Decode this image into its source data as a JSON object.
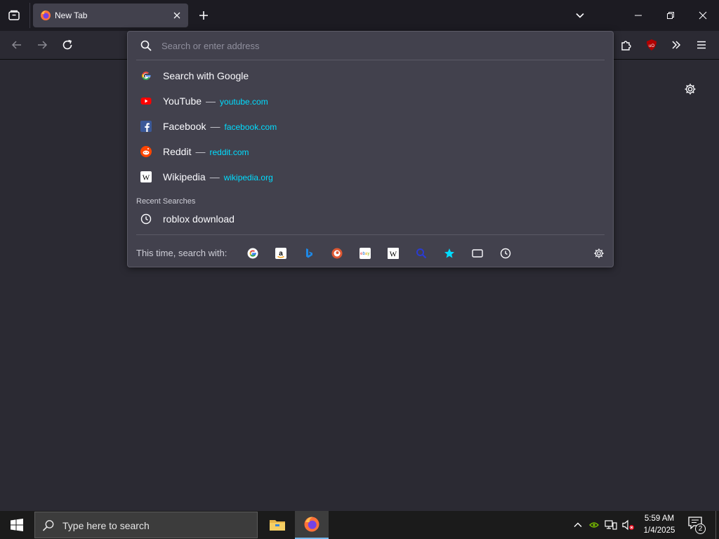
{
  "browser": {
    "tab": {
      "title": "New Tab"
    },
    "urlbar": {
      "placeholder": "Search or enter address"
    }
  },
  "suggestions": {
    "search_google": "Search with Google",
    "sites": [
      {
        "name": "YouTube",
        "url": "youtube.com",
        "icon": "youtube-icon"
      },
      {
        "name": "Facebook",
        "url": "facebook.com",
        "icon": "facebook-icon"
      },
      {
        "name": "Reddit",
        "url": "reddit.com",
        "icon": "reddit-icon"
      },
      {
        "name": "Wikipedia",
        "url": "wikipedia.org",
        "icon": "wikipedia-icon"
      }
    ],
    "separator": "—",
    "recent_label": "Recent Searches",
    "recent": [
      {
        "text": "roblox download"
      }
    ]
  },
  "oneoffs": {
    "label": "This time, search with:",
    "engines": [
      "Google",
      "Amazon",
      "Bing",
      "DuckDuckGo",
      "eBay",
      "Wikipedia",
      "Search",
      "Bookmarks",
      "Tabs",
      "History"
    ]
  },
  "taskbar": {
    "search_placeholder": "Type here to search",
    "time": "5:59 AM",
    "date": "1/4/2025",
    "notification_count": "2"
  },
  "colors": {
    "accent_url": "#00ddff",
    "popup_bg": "#42414d",
    "page_bg": "#2b2a33",
    "titlebar_bg": "#1c1b22",
    "taskbar_bg": "#1b1b1b"
  }
}
